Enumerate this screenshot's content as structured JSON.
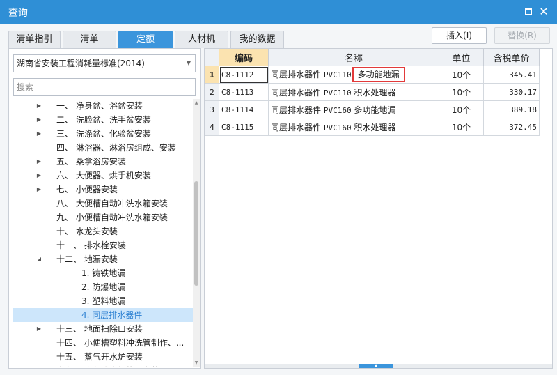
{
  "window": {
    "title": "查询",
    "maximize_icon": "maximize-icon",
    "close_glyph": "✕"
  },
  "tabs": [
    {
      "label": "清单指引",
      "active": false
    },
    {
      "label": "清单",
      "active": false
    },
    {
      "label": "定额",
      "active": true
    },
    {
      "label": "人材机",
      "active": false
    },
    {
      "label": "我的数据",
      "active": false
    }
  ],
  "buttons": {
    "insert": "插入(I)",
    "replace": "替换(R)"
  },
  "left": {
    "library": "湖南省安装工程消耗量标准(2014)",
    "search_placeholder": "搜索",
    "tree": [
      {
        "label": "一、 净身盆、浴盆安装",
        "arrow": "▶",
        "level": 0
      },
      {
        "label": "二、 洗脸盆、洗手盆安装",
        "arrow": "▶",
        "level": 0
      },
      {
        "label": "三、 洗涤盆、化验盆安装",
        "arrow": "▶",
        "level": 0
      },
      {
        "label": "四、 淋浴器、淋浴房组成、安装",
        "arrow": "",
        "level": 0
      },
      {
        "label": "五、 桑拿浴房安装",
        "arrow": "▶",
        "level": 0
      },
      {
        "label": "六、 大便器、烘手机安装",
        "arrow": "▶",
        "level": 0
      },
      {
        "label": "七、 小便器安装",
        "arrow": "▶",
        "level": 0
      },
      {
        "label": "八、 大便槽自动冲洗水箱安装",
        "arrow": "",
        "level": 0
      },
      {
        "label": "九、 小便槽自动冲洗水箱安装",
        "arrow": "",
        "level": 0
      },
      {
        "label": "十、 水龙头安装",
        "arrow": "",
        "level": 0
      },
      {
        "label": "十一、 排水栓安装",
        "arrow": "",
        "level": 0
      },
      {
        "label": "十二、 地漏安装",
        "arrow": "◢",
        "level": 0
      },
      {
        "label": "1. 铸铁地漏",
        "arrow": "",
        "level": 1
      },
      {
        "label": "2. 防爆地漏",
        "arrow": "",
        "level": 1
      },
      {
        "label": "3. 塑料地漏",
        "arrow": "",
        "level": 1
      },
      {
        "label": "4. 同层排水器件",
        "arrow": "",
        "level": 1,
        "selected": true
      },
      {
        "label": "十三、 地面扫除口安装",
        "arrow": "▶",
        "level": 0
      },
      {
        "label": "十四、 小便槽塑料冲洗管制作、...",
        "arrow": "",
        "level": 0
      },
      {
        "label": "十五、 蒸气开水炉安装",
        "arrow": "",
        "level": 0
      },
      {
        "label": "十六、 容积式水加热器安装",
        "arrow": "",
        "level": 0
      }
    ]
  },
  "grid": {
    "headers": [
      "编码",
      "名称",
      "单位",
      "含税单价"
    ],
    "rows": [
      {
        "num": "1",
        "code": "C8-1112",
        "name_prefix": "同层排水器件",
        "name_spec": "PVC110",
        "name_suffix": "多功能地漏",
        "unit": "10个",
        "price": "345.41"
      },
      {
        "num": "2",
        "code": "C8-1113",
        "name_prefix": "同层排水器件",
        "name_spec": "PVC110",
        "name_suffix": "积水处理器",
        "unit": "10个",
        "price": "330.17"
      },
      {
        "num": "3",
        "code": "C8-1114",
        "name_prefix": "同层排水器件",
        "name_spec": "PVC160",
        "name_suffix": "多功能地漏",
        "unit": "10个",
        "price": "389.18"
      },
      {
        "num": "4",
        "code": "C8-1115",
        "name_prefix": "同层排水器件",
        "name_spec": "PVC160",
        "name_suffix": "积水处理器",
        "unit": "10个",
        "price": "372.45"
      }
    ]
  }
}
